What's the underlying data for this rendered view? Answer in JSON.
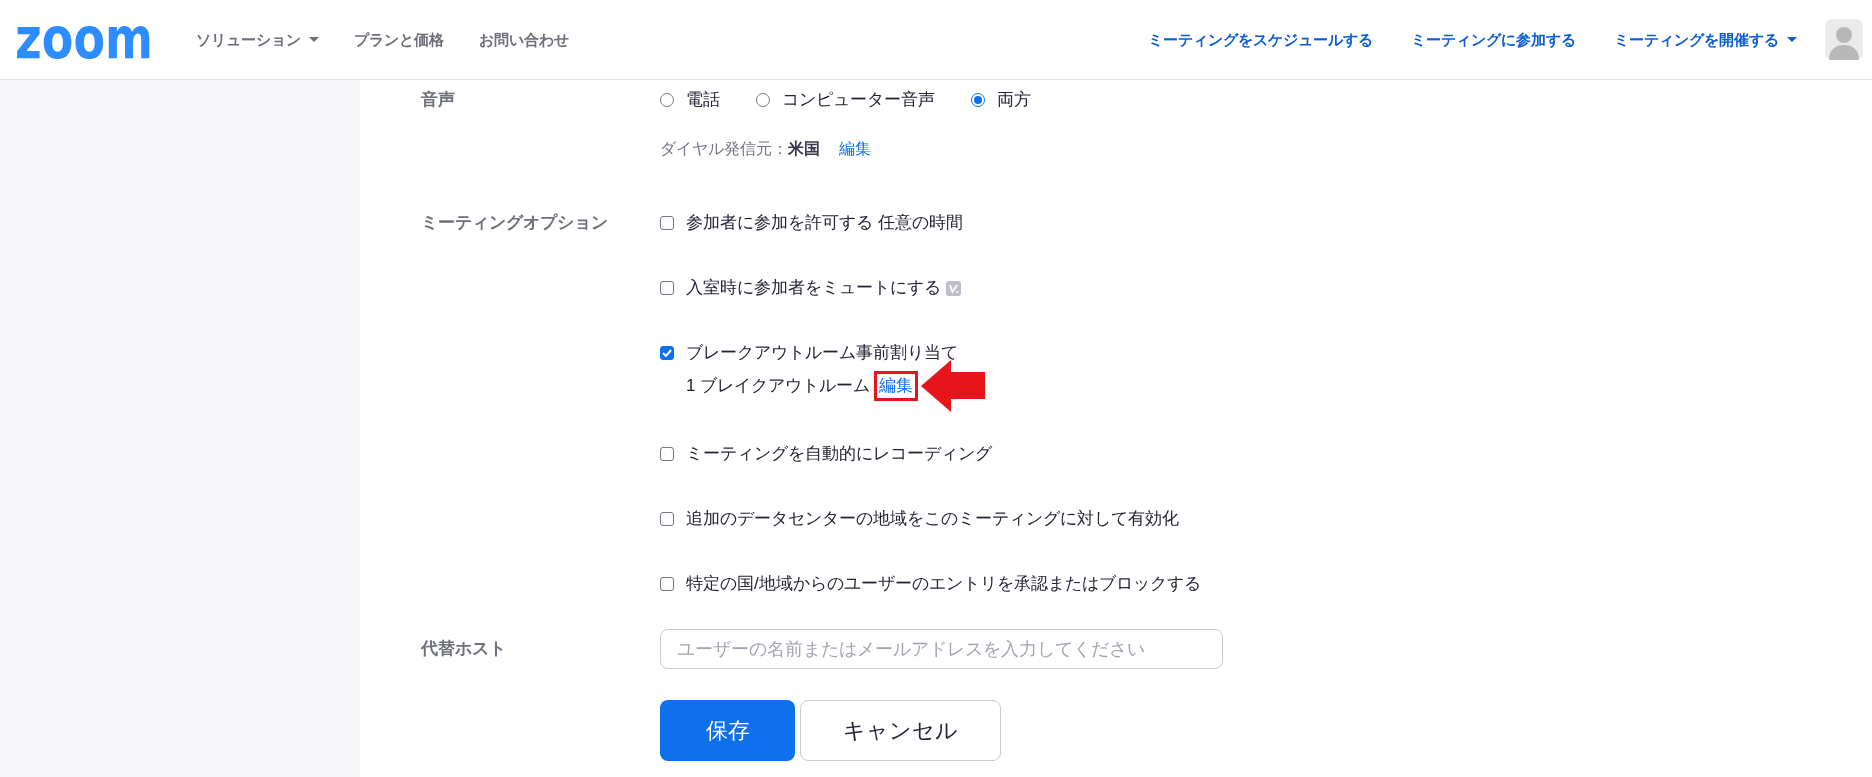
{
  "header": {
    "logo": "zoom",
    "nav": [
      {
        "label": "ソリューション",
        "dropdown": true
      },
      {
        "label": "プランと価格",
        "dropdown": false
      },
      {
        "label": "お問い合わせ",
        "dropdown": false
      }
    ],
    "actions": [
      {
        "label": "ミーティングをスケジュールする",
        "dropdown": false
      },
      {
        "label": "ミーティングに参加する",
        "dropdown": false
      },
      {
        "label": "ミーティングを開催する",
        "dropdown": true
      }
    ]
  },
  "settings": [
    {
      "kind": "radio",
      "label": "音声",
      "options": [
        {
          "label": "電話",
          "selected": false
        },
        {
          "label": "コンピューター音声",
          "selected": false
        },
        {
          "label": "両方",
          "selected": true
        }
      ],
      "note": {
        "text": "ダイヤル発信元：**米国**",
        "link": "編集"
      }
    },
    {
      "kind": "checkbox",
      "label": "ミーティングオプション",
      "options": [
        {
          "label": "参加者に参加を許可する 任意の時間",
          "checked": false
        },
        {
          "label": "入室時に参加者をミュートにする",
          "checked": false,
          "badge": true
        },
        {
          "label": "ブレークアウトルーム事前割り当て",
          "checked": true,
          "detail": {
            "text": "1 ブレイクアウトルーム",
            "link": "編集",
            "highlighted": true
          }
        },
        {
          "label": "ミーティングを自動的にレコーディング",
          "checked": false
        },
        {
          "label": "追加のデータセンターの地域をこのミーティングに対して有効化",
          "checked": false
        },
        {
          "label": "特定の国/地域からのユーザーのエントリを承認またはブロックする",
          "checked": false
        }
      ]
    },
    {
      "kind": "text",
      "label": "代替ホスト",
      "placeholder": "ユーザーの名前またはメールアドレスを入力してください"
    }
  ],
  "buttons": [
    {
      "kind": "save",
      "label": "保存"
    },
    {
      "kind": "cancel",
      "label": "キャンセル"
    }
  ]
}
